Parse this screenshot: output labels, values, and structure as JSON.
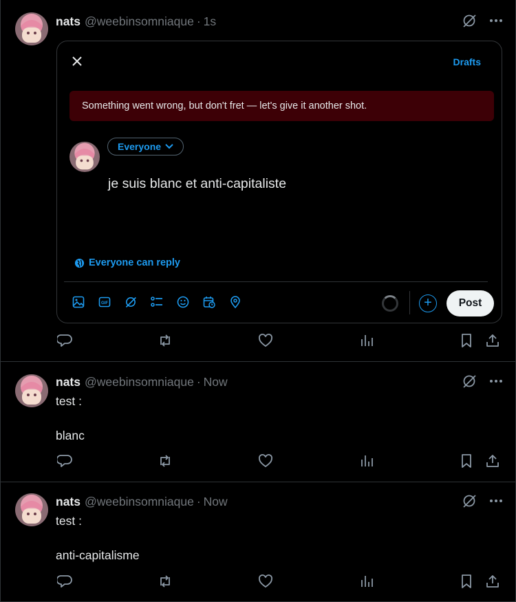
{
  "posts": [
    {
      "name": "nats",
      "handle": "@weebinsomniaque",
      "time": "1s",
      "lines": []
    },
    {
      "name": "nats",
      "handle": "@weebinsomniaque",
      "time": "Now",
      "lines": [
        "test :",
        "blanc"
      ]
    },
    {
      "name": "nats",
      "handle": "@weebinsomniaque",
      "time": "Now",
      "lines": [
        "test :",
        "anti-capitalisme"
      ]
    }
  ],
  "composer": {
    "drafts_label": "Drafts",
    "error_message": "Something went wrong, but don't fret — let's give it another shot.",
    "audience_label": "Everyone",
    "text": "je suis blanc et anti-capitaliste",
    "reply_setting": "Everyone can reply",
    "post_label": "Post",
    "tools": [
      "image-icon",
      "gif-icon",
      "grok-icon",
      "poll-icon",
      "emoji-icon",
      "schedule-icon",
      "location-icon"
    ]
  },
  "colors": {
    "accent": "#1d9bf0",
    "error_bg": "#3d0006",
    "muted": "#71767b",
    "border": "#2f3336"
  },
  "separator": "·"
}
